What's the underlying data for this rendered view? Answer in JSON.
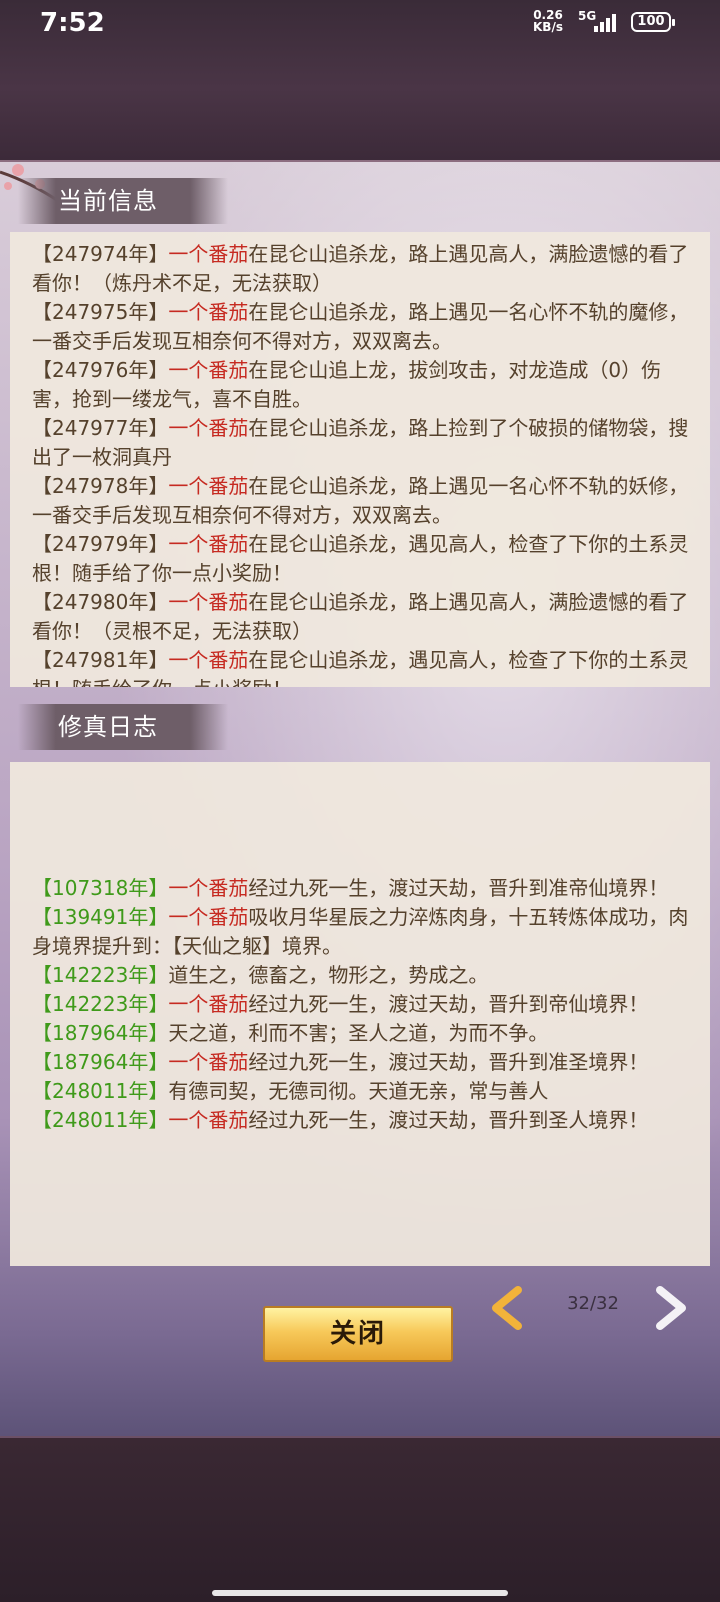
{
  "status_bar": {
    "time": "7:52",
    "net_speed_value": "0.26",
    "net_speed_unit": "KB/s",
    "network": "5G",
    "battery": "100"
  },
  "current_info": {
    "title": "当前信息",
    "entries": [
      {
        "year": "【247974年】",
        "name": "一个番茄",
        "text": "在昆仑山追杀龙，路上遇见高人，满脸遗憾的看了看你！（炼丹术不足，无法获取）"
      },
      {
        "year": "【247975年】",
        "name": "一个番茄",
        "text": "在昆仑山追杀龙，路上遇见一名心怀不轨的魔修，一番交手后发现互相奈何不得对方，双双离去。"
      },
      {
        "year": "【247976年】",
        "name": "一个番茄",
        "text": "在昆仑山追上龙，拔剑攻击，对龙造成（0）伤害，抢到一缕龙气，喜不自胜。"
      },
      {
        "year": "【247977年】",
        "name": "一个番茄",
        "text": "在昆仑山追杀龙，路上捡到了个破损的储物袋，搜出了一枚洞真丹"
      },
      {
        "year": "【247978年】",
        "name": "一个番茄",
        "text": "在昆仑山追杀龙，路上遇见一名心怀不轨的妖修，一番交手后发现互相奈何不得对方，双双离去。"
      },
      {
        "year": "【247979年】",
        "name": "一个番茄",
        "text": "在昆仑山追杀龙，遇见高人，检查了下你的土系灵根！随手给了你一点小奖励！"
      },
      {
        "year": "【247980年】",
        "name": "一个番茄",
        "text": "在昆仑山追杀龙，路上遇见高人，满脸遗憾的看了看你！（灵根不足，无法获取）"
      },
      {
        "year": "【247981年】",
        "name": "一个番茄",
        "text": "在昆仑山追杀龙，遇见高人，检查了下你的土系灵根！随手给了你一点小奖励！"
      }
    ]
  },
  "cultivation_log": {
    "title": "修真日志",
    "entries": [
      {
        "year": "【107318年】",
        "name": "一个番茄",
        "text": "经过九死一生，渡过天劫，晋升到准帝仙境界！"
      },
      {
        "year": "【139491年】",
        "name": "一个番茄",
        "text": "吸收月华星辰之力淬炼肉身，十五转炼体成功，肉身境界提升到：【天仙之躯】境界。"
      },
      {
        "year": "【142223年】",
        "name": "",
        "text": "道生之，德畜之，物形之，势成之。"
      },
      {
        "year": "【142223年】",
        "name": "一个番茄",
        "text": "经过九死一生，渡过天劫，晋升到帝仙境界！"
      },
      {
        "year": "【187964年】",
        "name": "",
        "text": "天之道，利而不害；圣人之道，为而不争。"
      },
      {
        "year": "【187964年】",
        "name": "一个番茄",
        "text": "经过九死一生，渡过天劫，晋升到准圣境界！"
      },
      {
        "year": "【248011年】",
        "name": "",
        "text": "有德司契，无德司彻。天道无亲，常与善人"
      },
      {
        "year": "【248011年】",
        "name": "一个番茄",
        "text": "经过九死一生，渡过天劫，晋升到圣人境界！"
      }
    ]
  },
  "controls": {
    "close_label": "关闭",
    "page_indicator": "32/32",
    "prev_icon": "chevron-left-icon",
    "next_icon": "chevron-right-icon"
  },
  "colors": {
    "name_red": "#c62a21",
    "year_green": "#3f9a1a",
    "body_brown": "#55412c",
    "button_gold": "#f7c95a"
  }
}
